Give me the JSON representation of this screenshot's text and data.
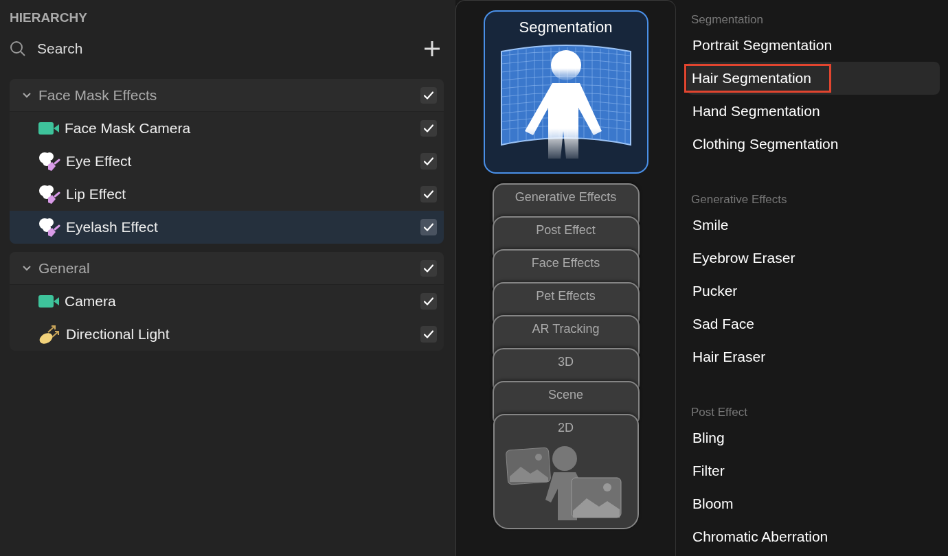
{
  "hierarchy": {
    "title": "HIERARCHY",
    "search": {
      "placeholder": "Search"
    },
    "groups": [
      {
        "title": "Face Mask Effects",
        "expanded": true,
        "checked": true,
        "items": [
          {
            "label": "Face Mask Camera",
            "kind": "camera",
            "checked": true,
            "selected": false
          },
          {
            "label": "Eye Effect",
            "kind": "effect",
            "checked": true,
            "selected": false
          },
          {
            "label": "Lip Effect",
            "kind": "effect",
            "checked": true,
            "selected": false
          },
          {
            "label": "Eyelash Effect",
            "kind": "effect",
            "checked": true,
            "selected": true
          }
        ]
      },
      {
        "title": "General",
        "expanded": true,
        "checked": true,
        "items": [
          {
            "label": "Camera",
            "kind": "camera",
            "checked": true,
            "selected": false
          },
          {
            "label": "Directional Light",
            "kind": "light",
            "checked": true,
            "selected": false
          }
        ]
      }
    ]
  },
  "categories": [
    {
      "label": "Segmentation",
      "kind": "featured",
      "selected": true
    },
    {
      "label": "Generative Effects",
      "kind": "stacked",
      "selected": false
    },
    {
      "label": "Post Effect",
      "kind": "stacked",
      "selected": false
    },
    {
      "label": "Face Effects",
      "kind": "stacked",
      "selected": false
    },
    {
      "label": "Pet Effects",
      "kind": "stacked",
      "selected": false
    },
    {
      "label": "AR Tracking",
      "kind": "stacked",
      "selected": false
    },
    {
      "label": "3D",
      "kind": "stacked",
      "selected": false
    },
    {
      "label": "Scene",
      "kind": "stacked",
      "selected": false
    },
    {
      "label": "2D",
      "kind": "base",
      "selected": false
    }
  ],
  "sections": [
    {
      "title": "Segmentation",
      "items": [
        {
          "label": "Portrait Segmentation",
          "selected": false,
          "callout": false
        },
        {
          "label": "Hair Segmentation",
          "selected": true,
          "callout": true
        },
        {
          "label": "Hand Segmentation",
          "selected": false,
          "callout": false
        },
        {
          "label": "Clothing Segmentation",
          "selected": false,
          "callout": false
        }
      ]
    },
    {
      "title": "Generative Effects",
      "items": [
        {
          "label": "Smile",
          "selected": false,
          "callout": false
        },
        {
          "label": "Eyebrow Eraser",
          "selected": false,
          "callout": false
        },
        {
          "label": "Pucker",
          "selected": false,
          "callout": false
        },
        {
          "label": "Sad Face",
          "selected": false,
          "callout": false
        },
        {
          "label": "Hair Eraser",
          "selected": false,
          "callout": false
        }
      ]
    },
    {
      "title": "Post Effect",
      "items": [
        {
          "label": "Bling",
          "selected": false,
          "callout": false
        },
        {
          "label": "Filter",
          "selected": false,
          "callout": false
        },
        {
          "label": "Bloom",
          "selected": false,
          "callout": false
        },
        {
          "label": "Chromatic Aberration",
          "selected": false,
          "callout": false
        }
      ]
    }
  ]
}
